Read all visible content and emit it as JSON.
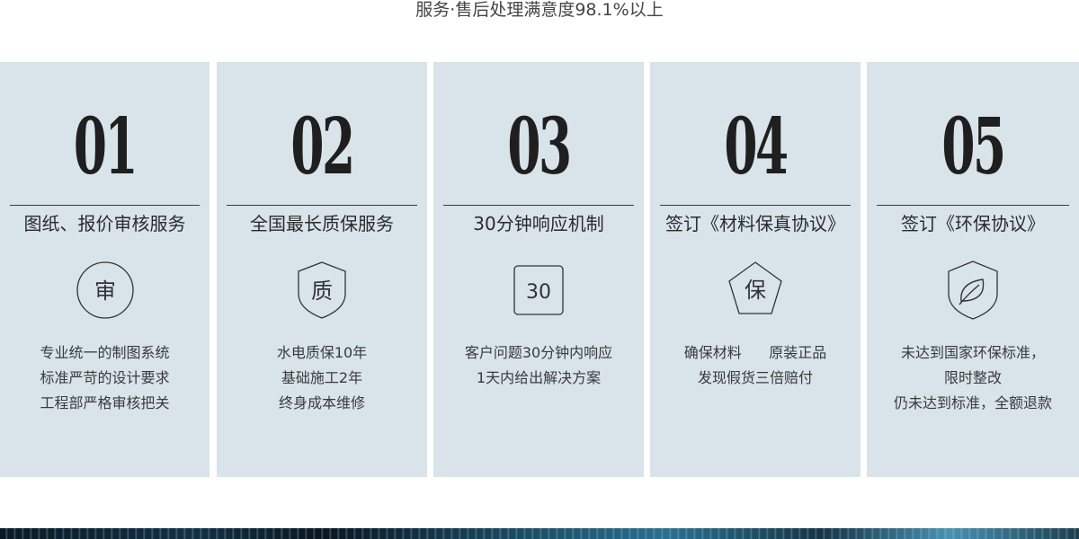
{
  "header": {
    "caption": "服务·售后处理满意度98.1%以上"
  },
  "cards": [
    {
      "number": "01",
      "title": "图纸、报价审核服务",
      "icon": {
        "name": "circle-badge-icon",
        "text": "审"
      },
      "lines": [
        "专业统一的制图系统",
        "标准严苛的设计要求",
        "工程部严格审核把关"
      ]
    },
    {
      "number": "02",
      "title": "全国最长质保服务",
      "icon": {
        "name": "shield-badge-icon",
        "text": "质"
      },
      "lines": [
        "水电质保10年",
        "基础施工2年",
        "终身成本维修"
      ]
    },
    {
      "number": "03",
      "title": "30分钟响应机制",
      "icon": {
        "name": "rounded-square-badge-icon",
        "text": "30"
      },
      "lines": [
        "客户问题30分钟内响应",
        "1天内给出解决方案"
      ]
    },
    {
      "number": "04",
      "title": "签订《材料保真协议》",
      "icon": {
        "name": "pentagon-badge-icon",
        "text": "保"
      },
      "lines": [
        "确保材料      原装正品",
        "发现假货三倍赔付"
      ]
    },
    {
      "number": "05",
      "title": "签订《环保协议》",
      "icon": {
        "name": "shield-leaf-icon",
        "text": ""
      },
      "lines": [
        "未达到国家环保标准，",
        "限时整改",
        "仍未达到标准，全额退款"
      ]
    }
  ],
  "colors": {
    "card_background": "#d8e4ea",
    "text_dark": "#1f1f1f",
    "text_body": "#3a3a3a"
  }
}
